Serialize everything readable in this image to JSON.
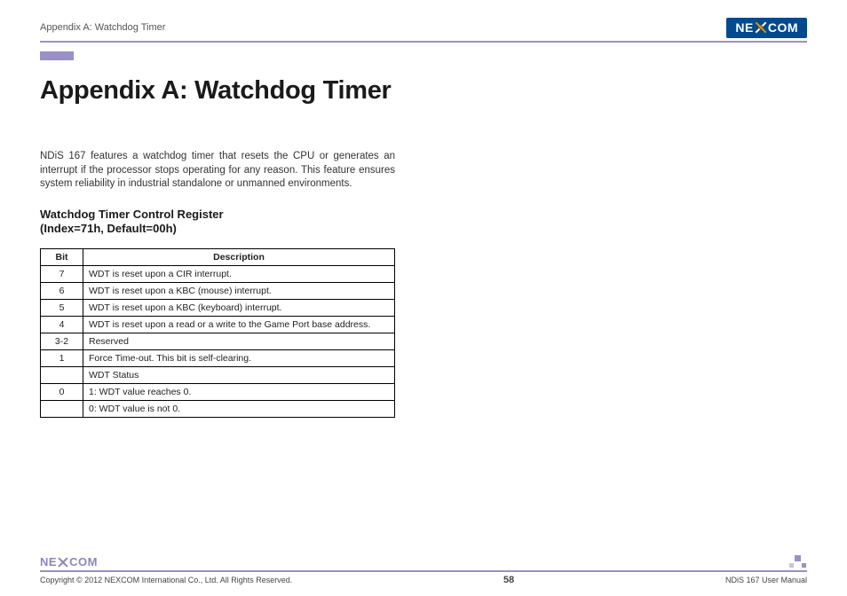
{
  "header": {
    "section_title": "Appendix A: Watchdog Timer",
    "logo_text_left": "NE",
    "logo_text_right": "COM"
  },
  "page_title": "Appendix A: Watchdog Timer",
  "intro": "NDiS 167 features a watchdog timer that resets the CPU or generates an interrupt if the processor stops operating for any reason. This feature ensures system reliability in industrial standalone or unmanned environments.",
  "section_heading_line1": "Watchdog Timer Control Register",
  "section_heading_line2": "(Index=71h, Default=00h)",
  "table": {
    "headers": {
      "bit": "Bit",
      "desc": "Description"
    },
    "rows": [
      {
        "bit": "7",
        "desc": "WDT is reset upon a CIR interrupt."
      },
      {
        "bit": "6",
        "desc": "WDT is reset upon a KBC (mouse) interrupt."
      },
      {
        "bit": "5",
        "desc": "WDT is reset upon a KBC (keyboard) interrupt."
      },
      {
        "bit": "4",
        "desc": "WDT is reset upon a read or a write to the Game Port base address."
      },
      {
        "bit": "3-2",
        "desc": "Reserved"
      },
      {
        "bit": "1",
        "desc": "Force Time-out. This bit is self-clearing."
      },
      {
        "bit": "",
        "desc": "WDT Status"
      },
      {
        "bit": "0",
        "desc": "1: WDT value reaches 0."
      },
      {
        "bit": "",
        "desc": "0: WDT value is not 0."
      }
    ]
  },
  "footer": {
    "logo_left": "NE",
    "logo_right": "COM",
    "copyright": "Copyright © 2012 NEXCOM International Co., Ltd. All Rights Reserved.",
    "page_number": "58",
    "manual": "NDiS 167 User Manual"
  }
}
